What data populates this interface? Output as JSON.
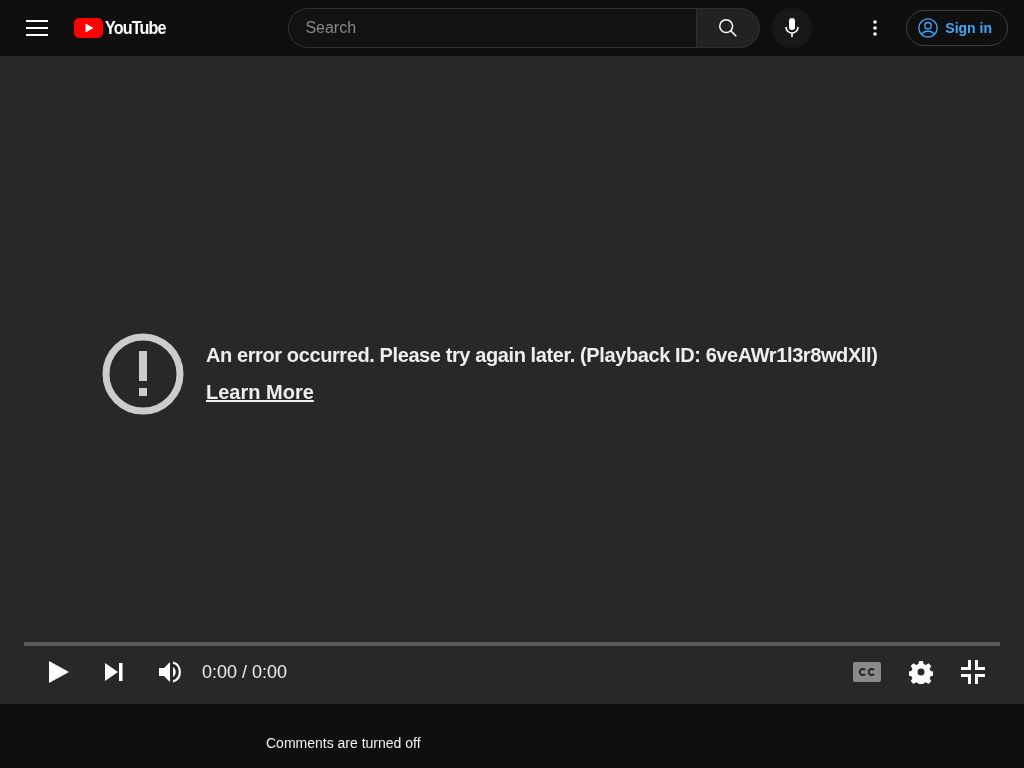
{
  "header": {
    "logo": "YouTube",
    "search": {
      "placeholder": "Search"
    },
    "sign_in": "Sign in"
  },
  "player": {
    "error": {
      "message": "An error occurred. Please try again later. (Playback ID: 6veAWr1l3r8wdXll)",
      "link": "Learn More"
    },
    "progress": {
      "level": 0
    },
    "time": "0:00 / 0:00",
    "captions": {
      "disabled": true
    }
  },
  "comments": {
    "message": "Comments are turned off"
  }
}
